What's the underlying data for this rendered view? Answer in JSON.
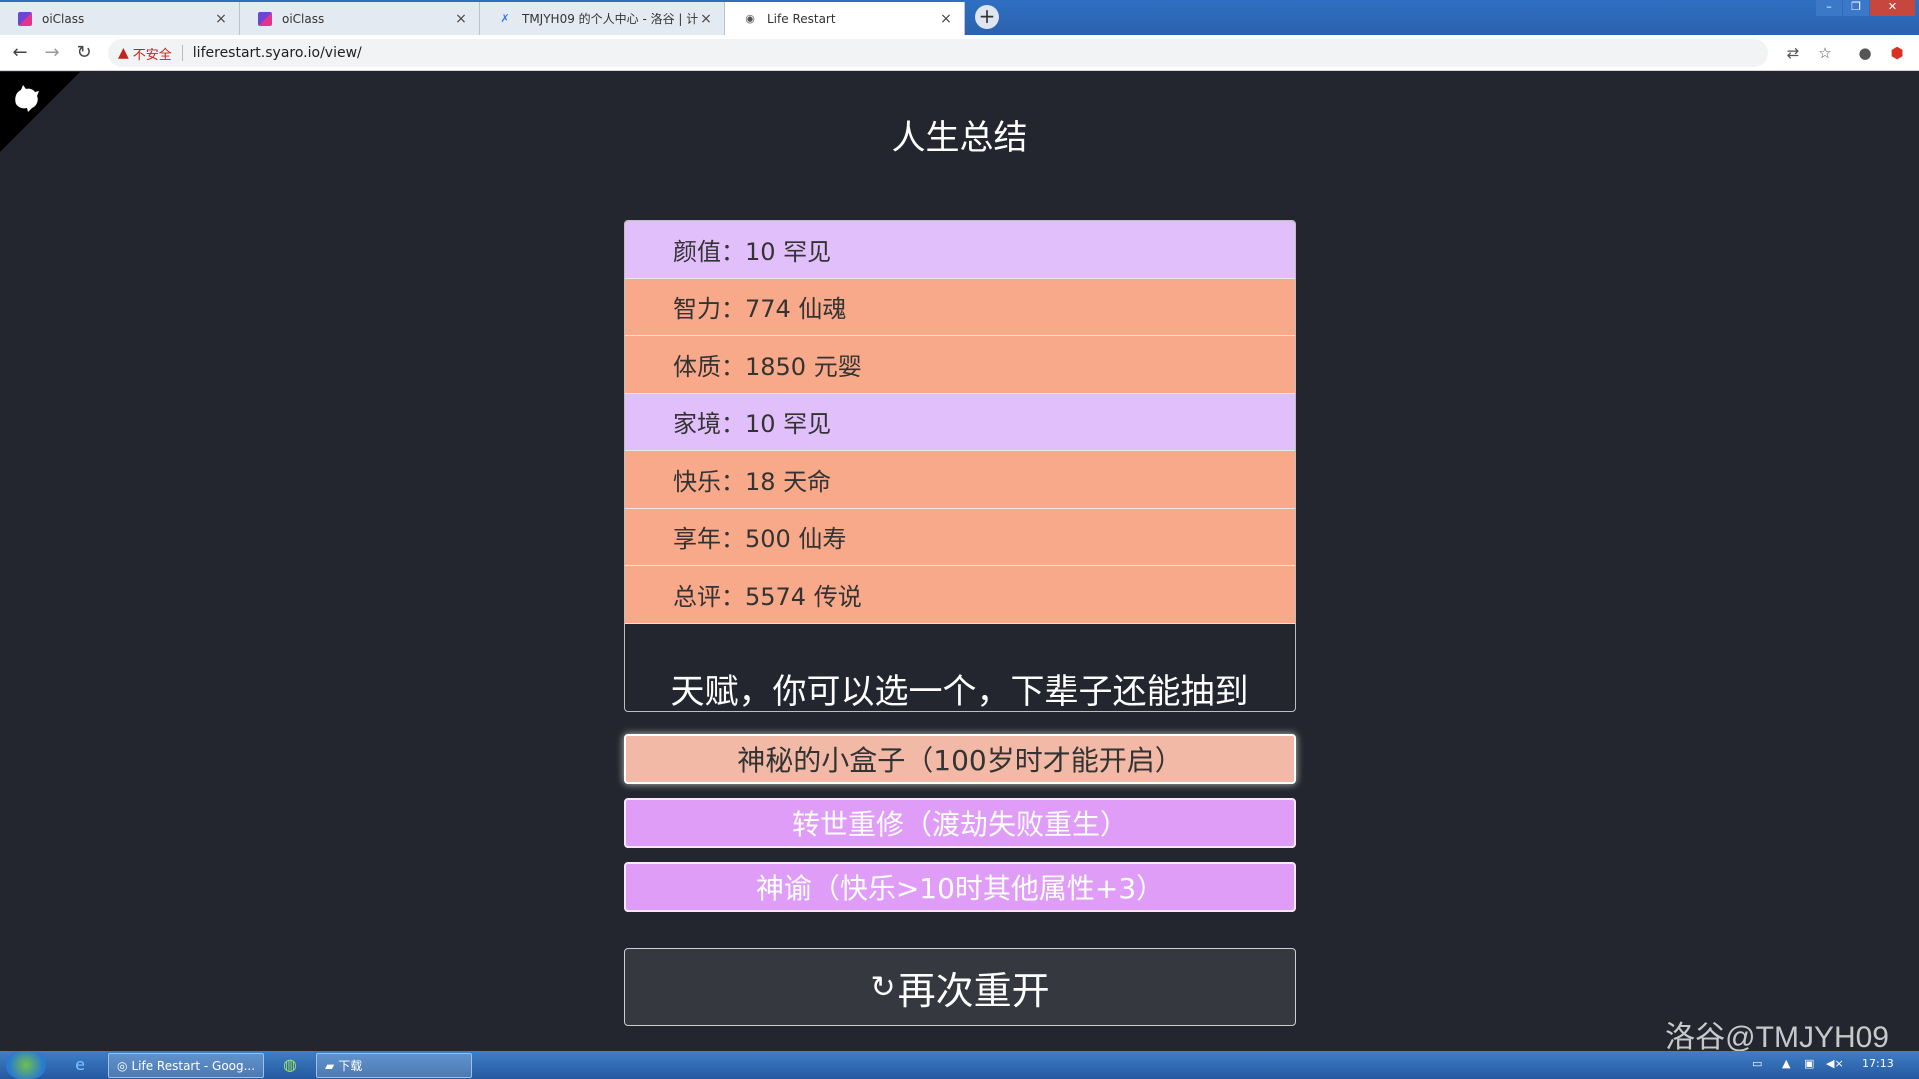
{
  "browser": {
    "tabs": [
      {
        "title": "oiClass",
        "icon": "oiclass-icon"
      },
      {
        "title": "oiClass",
        "icon": "oiclass-icon"
      },
      {
        "title": "TMJYH09 的个人中心 - 洛谷 | 计",
        "icon": "luogu-icon"
      },
      {
        "title": "Life Restart",
        "icon": "globe-icon",
        "active": true
      }
    ],
    "security_label": "不安全",
    "url": "liferestart.syaro.io/view/"
  },
  "page": {
    "title": "人生总结",
    "summary": [
      {
        "label": "颜值：10 罕见",
        "grade": "common"
      },
      {
        "label": "智力：774 仙魂",
        "grade": "legend"
      },
      {
        "label": "体质：1850 元婴",
        "grade": "legend"
      },
      {
        "label": "家境：10 罕见",
        "grade": "common"
      },
      {
        "label": "快乐：18 天命",
        "grade": "legend"
      },
      {
        "label": "享年：500 仙寿",
        "grade": "legend"
      },
      {
        "label": "总评：5574 传说",
        "grade": "legend"
      }
    ],
    "talent_title": "天赋，你可以选一个，下辈子还能抽到",
    "talents": [
      {
        "label": "神秘的小盒子（100岁时才能开启）",
        "selected": true
      },
      {
        "label": "转世重修（渡劫失败重生）",
        "selected": false
      },
      {
        "label": "神谕（快乐>10时其他属性+3）",
        "selected": false
      }
    ],
    "restart_label": "再次重开",
    "watermark": "洛谷@TMJYH09"
  },
  "taskbar": {
    "tasks": [
      {
        "label": "Life Restart - Goog..."
      },
      {
        "label": "下载"
      }
    ],
    "clock": "17:13"
  },
  "colors": {
    "background": "#23262e",
    "grade_common": "#e0bffb",
    "grade_legend": "#f7a98a",
    "talent_selected": "#f2b9a6",
    "talent_purple": "#e09df8"
  }
}
